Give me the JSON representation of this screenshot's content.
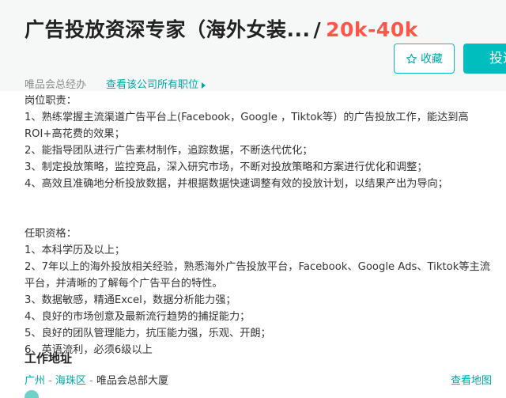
{
  "header": {
    "job_title": "广告投放资深专家（海外女装...",
    "separator": "/",
    "salary": "20k-40k",
    "favorite_label": "收藏",
    "apply_label": "投递",
    "company_name": "唯品会总经办",
    "company_link": "查看该公司所有职位"
  },
  "description": {
    "lines": [
      "岗位职责：",
      "1、熟练掌握主流渠道广告平台上(Facebook，Google ，Tiktok等）的广告投放工作，能达到高ROI+高花费的效果；",
      "2、能指导团队进行广告素材制作，追踪数据，不断迭代优化；",
      "3、制定投放策略，监控竞品，深入研究市场，不断对投放策略和方案进行优化和调整；",
      "4、高效且准确地分析投放数据，并根据数据快速调整有效的投放计划，以结果产出为导向；",
      "任职资格：",
      "1、本科学历及以上；",
      "2、7年以上的海外投放相关经验，熟悉海外广告投放平台，Facebook、Google Ads、Tiktok等主流平台，并清晰的了解每个广告平台的特性。",
      "3、数据敏感，精通Excel，数据分析能力强；",
      "4、良好的市场创意及最新流行趋势的捕捉能力；",
      "5、良好的团队管理能力，抗压能力强，乐观、开朗；",
      "6、英语流利，必须6级以上"
    ]
  },
  "address": {
    "section_title": "工作地址",
    "city": "广州",
    "dash1": "-",
    "district": "海珠区",
    "dash2": "-",
    "place": "唯品会总部大厦",
    "map_link": "查看地图"
  },
  "icons": {
    "favorite": "star-icon",
    "company_link": "caret-right-icon"
  },
  "colors": {
    "accent": "#00bebd",
    "salary": "#fe574a"
  }
}
